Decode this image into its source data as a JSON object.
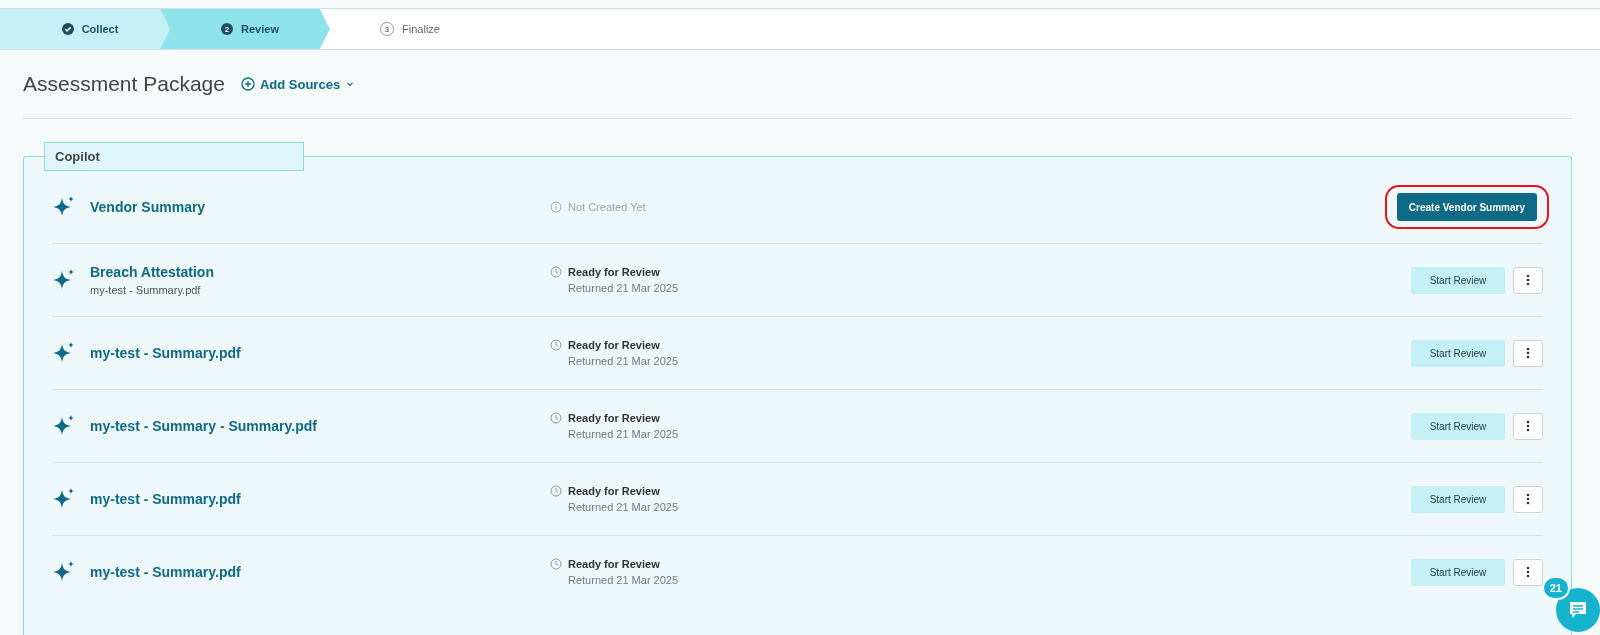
{
  "stepper": [
    {
      "label": "Collect",
      "completed": true,
      "selected": false
    },
    {
      "label": "Review",
      "number": "2",
      "completed": false,
      "selected": true
    },
    {
      "label": "Finalize",
      "number": "3",
      "completed": false,
      "selected": false
    }
  ],
  "header": {
    "title": "Assessment Package",
    "add_button": "Add Sources"
  },
  "section": {
    "title": "Copilot",
    "rows": [
      {
        "kind": "not_created",
        "title": "Vendor Summary",
        "status": "Not Created Yet",
        "action": "Create Vendor Summary",
        "highlighted": true
      },
      {
        "kind": "ready",
        "title": "Breach Attestation",
        "subtitle": "my-test - Summary.pdf",
        "status": "Ready for Review",
        "date": "Returned 21 Mar 2025",
        "action": "Start Review",
        "highlighted": false
      },
      {
        "kind": "ready",
        "title": "my-test - Summary.pdf",
        "status": "Ready for Review",
        "date": "Returned 21 Mar 2025",
        "action": "Start Review",
        "highlighted": false
      },
      {
        "kind": "ready",
        "title": "my-test - Summary - Summary.pdf",
        "status": "Ready for Review",
        "date": "Returned 21 Mar 2025",
        "action": "Start Review",
        "highlighted": false
      },
      {
        "kind": "ready",
        "title": "my-test - Summary.pdf",
        "status": "Ready for Review",
        "date": "Returned 21 Mar 2025",
        "action": "Start Review",
        "highlighted": false
      },
      {
        "kind": "ready",
        "title": "my-test - Summary.pdf",
        "status": "Ready for Review",
        "date": "Returned 21 Mar 2025",
        "action": "Start Review",
        "highlighted": false
      }
    ]
  },
  "chat": {
    "count": "21"
  }
}
